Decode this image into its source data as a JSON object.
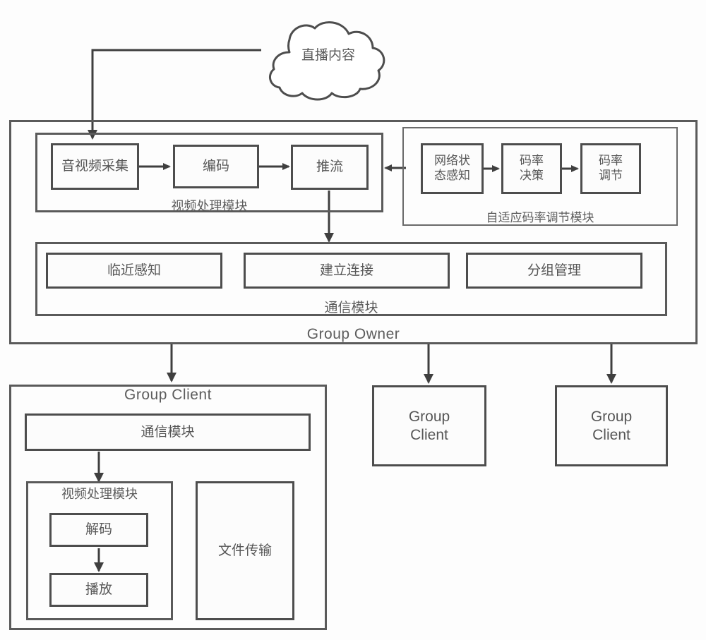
{
  "diagram": {
    "title_source_cloud": "直播内容",
    "group_owner": {
      "label": "Group Owner",
      "video_module": {
        "label": "视频处理模块",
        "nodes": [
          "音视频采集",
          "编码",
          "推流"
        ]
      },
      "bitrate_module": {
        "label": "自适应码率调节模块",
        "nodes": [
          "网络状\n态感知",
          "码率\n决策",
          "码率\n调节"
        ]
      },
      "comm_module": {
        "label": "通信模块",
        "nodes": [
          "临近感知",
          "建立连接",
          "分组管理"
        ]
      }
    },
    "group_client_detailed": {
      "label": "Group Client",
      "comm_module": "通信模块",
      "video_module": {
        "label": "视频处理模块",
        "nodes": [
          "解码",
          "播放"
        ]
      },
      "file_transfer": "文件传输"
    },
    "group_clients_simple": [
      {
        "label": "Group\nClient"
      },
      {
        "label": "Group\nClient"
      }
    ],
    "colors": {
      "stroke": "#4d4d4d",
      "text": "#565656",
      "background": "#fdfdfd"
    }
  }
}
